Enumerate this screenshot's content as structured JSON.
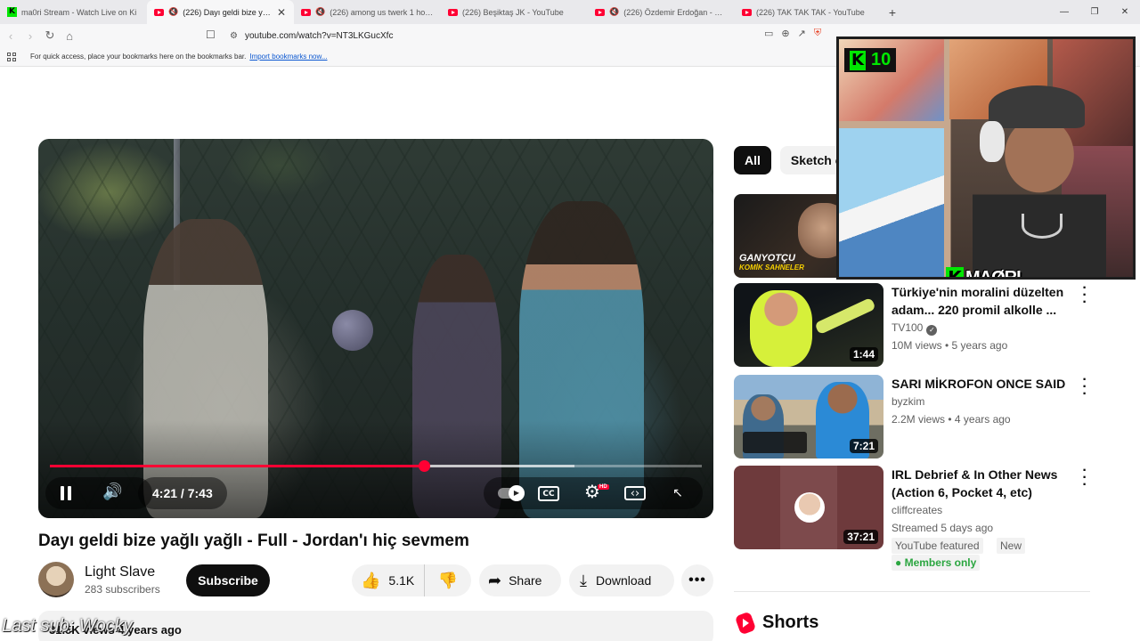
{
  "browser": {
    "tabs": [
      {
        "label": "ma0ri Stream - Watch Live on Ki",
        "icon": "kick-favicon-icon",
        "muted": false,
        "active": false
      },
      {
        "label": "(226) Dayı geldi bize yağlı yağ",
        "icon": "youtube-favicon-icon",
        "muted": true,
        "active": true
      },
      {
        "label": "(226) among us twerk 1 hour - Y",
        "icon": "youtube-favicon-icon",
        "muted": true,
        "active": false
      },
      {
        "label": "(226) Beşiktaş JK - YouTube",
        "icon": "youtube-favicon-icon",
        "muted": false,
        "active": false
      },
      {
        "label": "(226) Özdemir Erdoğan - Bir Bah",
        "icon": "youtube-favicon-icon",
        "muted": true,
        "active": false
      },
      {
        "label": "(226) TAK TAK TAK - YouTube",
        "icon": "youtube-favicon-icon",
        "muted": false,
        "active": false
      }
    ],
    "new_tab_label": "+",
    "url": "youtube.com/watch?v=NT3LKGucXfc",
    "bookmarks_hint": "For quick access, place your bookmarks here on the bookmarks bar.",
    "bookmarks_link": "Import bookmarks now..."
  },
  "player": {
    "progress_fraction": 0.574,
    "buffered_fraction": 0.805,
    "current_time": "4:21",
    "separator": "/",
    "duration": "7:43",
    "hd_badge": "HD",
    "cc_label": "CC"
  },
  "video": {
    "title": "Dayı geldi bize yağlı yağlı - Full - Jordan'ı hiç sevmem",
    "channel": "Light Slave",
    "subscribers": "283 subscribers",
    "subscribe_label": "Subscribe",
    "likes": "5.1K",
    "share_label": "Share",
    "download_label": "Download",
    "more_label": "•••",
    "description_partial": "31.5K views  4 years ago",
    "overlay_caption": "Last sub: Wocky"
  },
  "chips": [
    "All",
    "Sketch c"
  ],
  "recommendations": [
    {
      "title": "",
      "thumb_text_1": "GANYOTÇU",
      "thumb_text_2": "KOMİK SAHNELER",
      "duration": "",
      "channel": "",
      "meta": ""
    },
    {
      "title": "Türkiye'nin moralini düzelten adam... 220 promil alkolle ...",
      "duration": "1:44",
      "channel": "TV100",
      "verified": true,
      "meta": "10M views • 5 years ago"
    },
    {
      "title": "SARI MİKROFON ONCE SAID",
      "duration": "7:21",
      "channel": "byzkim",
      "verified": false,
      "meta": "2.2M views • 4 years ago"
    },
    {
      "title": "IRL Debrief & In Other News (Action 6, Pocket 4, etc)",
      "duration": "37:21",
      "channel": "cliffcreates",
      "verified": false,
      "meta": "Streamed 5 days ago",
      "badge_1": "YouTube featured",
      "badge_2": "New",
      "badge_members": "Members only"
    }
  ],
  "shorts_label": "Shorts",
  "webcam": {
    "badge_count": "10",
    "badge_k": "K",
    "name_k": "K",
    "name": "MAØRI"
  },
  "colors": {
    "accent_red": "#ff0033",
    "kick_green": "#00e701",
    "members_green": "#2ba640"
  }
}
